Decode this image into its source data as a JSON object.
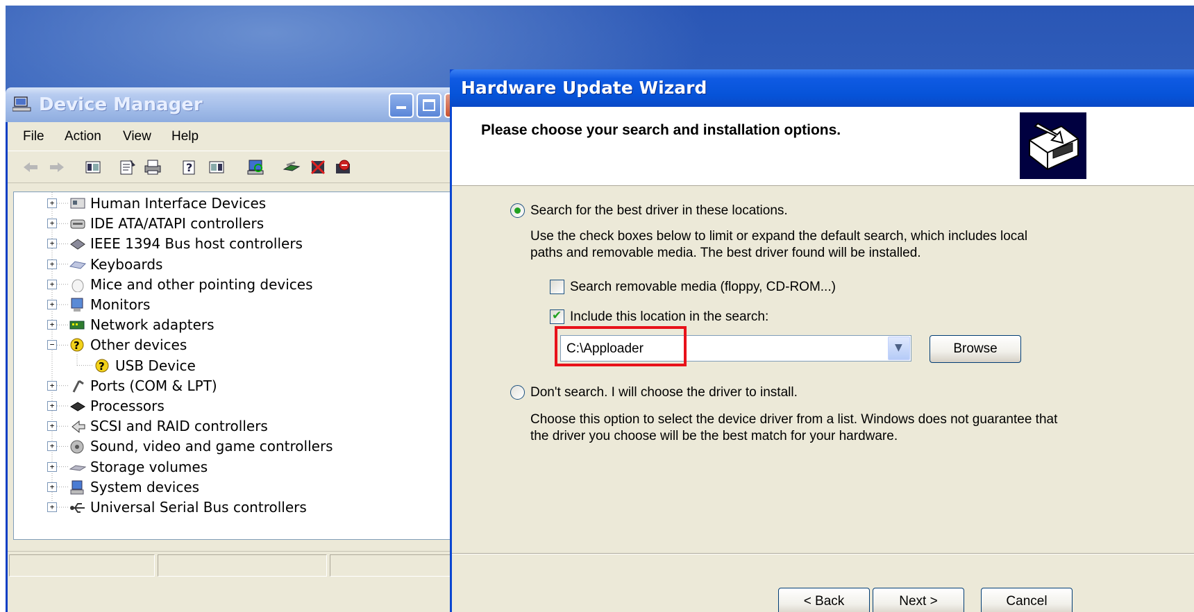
{
  "device_manager": {
    "title": "Device Manager",
    "menu": [
      "File",
      "Action",
      "View",
      "Help"
    ],
    "toolbar": [
      "back-icon",
      "forward-icon",
      "show-hide-tree-icon",
      "properties-icon",
      "print-icon",
      "help-icon",
      "view-icon",
      "scan-hardware-icon",
      "update-driver-icon",
      "disable-icon",
      "uninstall-icon"
    ],
    "tree": [
      {
        "label": "Human Interface Devices",
        "icon": "hid-icon",
        "expander": "+"
      },
      {
        "label": "IDE ATA/ATAPI controllers",
        "icon": "ide-icon",
        "expander": "+"
      },
      {
        "label": "IEEE 1394 Bus host controllers",
        "icon": "firewire-icon",
        "expander": "+"
      },
      {
        "label": "Keyboards",
        "icon": "keyboard-icon",
        "expander": "+"
      },
      {
        "label": "Mice and other pointing devices",
        "icon": "mouse-icon",
        "expander": "+"
      },
      {
        "label": "Monitors",
        "icon": "monitor-icon",
        "expander": "+"
      },
      {
        "label": "Network adapters",
        "icon": "network-icon",
        "expander": "+"
      },
      {
        "label": "Other devices",
        "icon": "unknown-device-icon",
        "expander": "−"
      },
      {
        "label": "USB Device",
        "icon": "unknown-device-icon",
        "child": true
      },
      {
        "label": "Ports (COM & LPT)",
        "icon": "port-icon",
        "expander": "+"
      },
      {
        "label": "Processors",
        "icon": "processor-icon",
        "expander": "+"
      },
      {
        "label": "SCSI and RAID controllers",
        "icon": "scsi-icon",
        "expander": "+"
      },
      {
        "label": "Sound, video and game controllers",
        "icon": "sound-icon",
        "expander": "+"
      },
      {
        "label": "Storage volumes",
        "icon": "storage-icon",
        "expander": "+"
      },
      {
        "label": "System devices",
        "icon": "system-icon",
        "expander": "+"
      },
      {
        "label": "Universal Serial Bus controllers",
        "icon": "usb-icon",
        "expander": "+"
      }
    ]
  },
  "wizard": {
    "title": "Hardware Update Wizard",
    "heading": "Please choose your search and installation options.",
    "option_search": {
      "label": "Search for the best driver in these locations.",
      "selected": true,
      "description_line1": "Use the check boxes below to limit or expand the default search, which includes local",
      "description_line2": "paths and removable media. The best driver found will be installed."
    },
    "check_removable": {
      "label": "Search removable media (floppy, CD-ROM...)",
      "checked": false
    },
    "check_location": {
      "label": "Include this location in the search:",
      "checked": true
    },
    "location_value": "C:\\Apploader",
    "browse_label": "Browse",
    "option_dont_search": {
      "label": "Don't search. I will choose the driver to install.",
      "selected": false,
      "description_line1": "Choose this option to select the device driver from a list.  Windows does not guarantee that",
      "description_line2": "the driver you choose will be the best match for your hardware."
    },
    "buttons": {
      "back": "< Back",
      "next": "Next >",
      "cancel": "Cancel"
    },
    "highlight_color": "#e8121a"
  }
}
